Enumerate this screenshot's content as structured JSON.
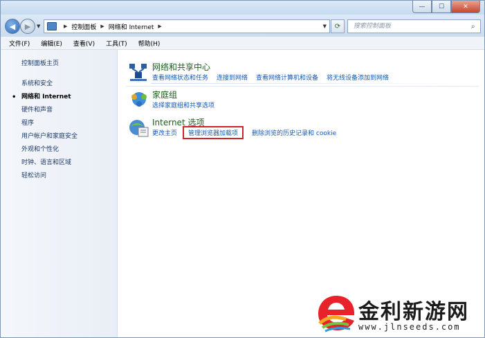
{
  "window": {
    "caption_buttons": {
      "minimize": "—",
      "maximize": "☐",
      "close": "✕"
    }
  },
  "address_bar": {
    "segments": [
      "控制面板",
      "网络和 Internet"
    ],
    "search_placeholder": "搜索控制面板"
  },
  "menu": {
    "items": [
      "文件(F)",
      "编辑(E)",
      "查看(V)",
      "工具(T)",
      "帮助(H)"
    ]
  },
  "sidebar": {
    "home": "控制面板主页",
    "items": [
      "系统和安全",
      "网络和 Internet",
      "硬件和声音",
      "程序",
      "用户帐户和家庭安全",
      "外观和个性化",
      "时钟、语言和区域",
      "轻松访问"
    ],
    "current_index": 1
  },
  "categories": [
    {
      "title": "网络和共享中心",
      "links": [
        "查看网络状态和任务",
        "连接到网络",
        "查看网络计算机和设备",
        "将无线设备添加到网络"
      ]
    },
    {
      "title": "家庭组",
      "links": [
        "选择家庭组和共享选项"
      ]
    },
    {
      "title": "Internet 选项",
      "links": [
        "更改主页",
        "管理浏览器加载项",
        "删除浏览的历史记录和 cookie"
      ],
      "highlighted_index": 1
    }
  ],
  "watermark": {
    "brand": "金利新游网",
    "site": "www.jlnseeds.com"
  },
  "colors": {
    "link": "#1659b0",
    "category_title": "#1a5d1a",
    "highlight_border": "#d0242a"
  }
}
